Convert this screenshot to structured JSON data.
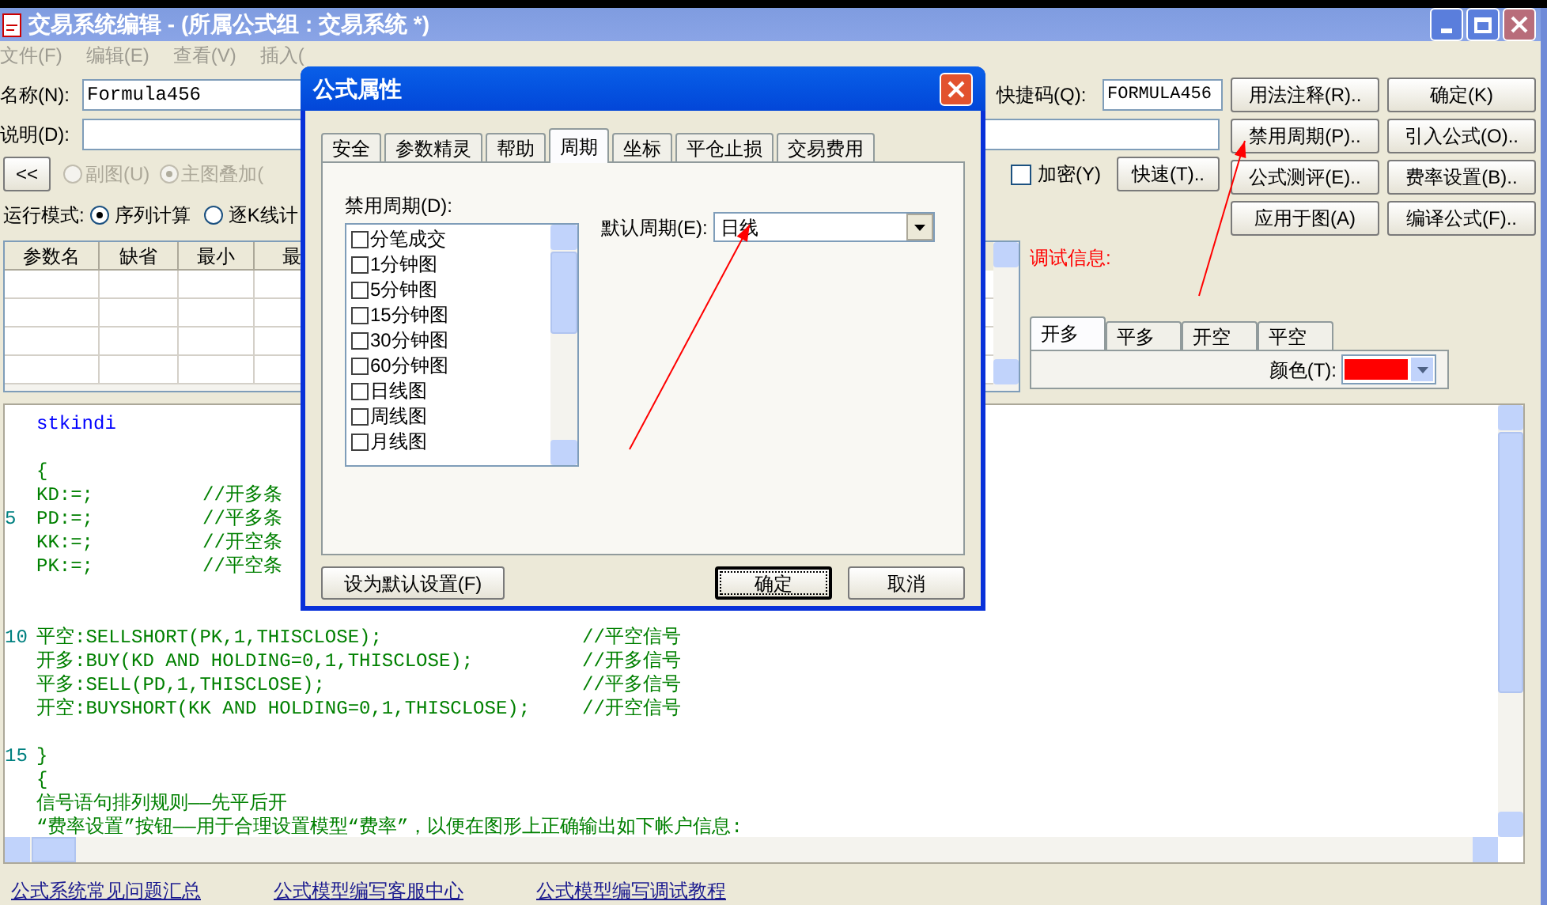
{
  "window": {
    "title": "交易系统编辑 - (所属公式组 : 交易系统 *)"
  },
  "menu": [
    "文件(F)",
    "编辑(E)",
    "查看(V)",
    "插入("
  ],
  "form": {
    "name_label": "名称(N):",
    "name_value": "Formula456",
    "shortcut_label": "快捷码(Q):",
    "shortcut_value": "FORMULA456",
    "desc_label": "说明(D):",
    "collapse_button": "<<",
    "chart_radios": [
      {
        "label": "副图(U)",
        "selected": false,
        "disabled": true
      },
      {
        "label": "主图叠加(",
        "selected": true,
        "disabled": true
      }
    ],
    "encrypt": {
      "label": "加密(Y)",
      "checked": false
    },
    "quick_button": "快速(T)..",
    "run_mode_label": "运行模式:",
    "run_modes": [
      {
        "label": "序列计算",
        "selected": true
      },
      {
        "label": "逐K线计",
        "selected": false
      }
    ]
  },
  "buttons": [
    "用法注释(R)..",
    "确定(K)",
    "禁用周期(P)..",
    "引入公式(O)..",
    "公式测评(E)..",
    "费率设置(B)..",
    "应用于图(A)",
    "编译公式(F).."
  ],
  "params_table": {
    "columns": [
      "参数名",
      "缺省",
      "最小",
      "最"
    ]
  },
  "debug": {
    "label": "调试信息:",
    "signal_tabs": [
      {
        "label": "开多",
        "selected": true
      },
      {
        "label": "平多",
        "selected": false
      },
      {
        "label": "开空",
        "selected": false
      },
      {
        "label": "平空",
        "selected": false
      }
    ],
    "color_label": "颜色(T):",
    "color": "#ff0000"
  },
  "editor": {
    "lines": [
      {
        "kind": "keyword",
        "code": "stkindi"
      },
      {
        "kind": "blank"
      },
      {
        "kind": "decl",
        "code": "{"
      },
      {
        "kind": "decl",
        "code": "KD:=;",
        "comment": "//开多条"
      },
      {
        "kind": "decl",
        "number": "5",
        "code": "PD:=;",
        "comment": "//平多条"
      },
      {
        "kind": "decl",
        "code": "KK:=;",
        "comment": "//开空条"
      },
      {
        "kind": "decl",
        "code": "PK:=;",
        "comment": "//平空条"
      },
      {
        "kind": "blank"
      },
      {
        "kind": "blank"
      },
      {
        "kind": "signal",
        "number": "10",
        "code": "平空:SELLSHORT(PK,1,THISCLOSE);",
        "comment": "//平空信号"
      },
      {
        "kind": "signal",
        "code": "开多:BUY(KD AND HOLDING=0,1,THISCLOSE);",
        "comment": "//开多信号"
      },
      {
        "kind": "signal",
        "code": "平多:SELL(PD,1,THISCLOSE);",
        "comment": "//平多信号"
      },
      {
        "kind": "signal",
        "code": "开空:BUYSHORT(KK AND HOLDING=0,1,THISCLOSE);",
        "comment": "//开空信号"
      },
      {
        "kind": "blank"
      },
      {
        "kind": "plain",
        "number": "15",
        "code": "}"
      },
      {
        "kind": "plain",
        "code": "{"
      },
      {
        "kind": "plain",
        "code": "信号语句排列规则——先平后开"
      },
      {
        "kind": "plain",
        "code": "“费率设置”按钮——用于合理设置模型“费率”，以便在图形上正确输出如下帐户信息:"
      }
    ]
  },
  "footer_links": [
    "公式系统常见问题汇总",
    "公式模型编写客服中心",
    "公式模型编写调试教程"
  ],
  "dialog": {
    "title": "公式属性",
    "tabs": [
      {
        "label": "安全",
        "selected": false
      },
      {
        "label": "参数精灵",
        "selected": false
      },
      {
        "label": "帮助",
        "selected": false
      },
      {
        "label": "周期",
        "selected": true
      },
      {
        "label": "坐标",
        "selected": false
      },
      {
        "label": "平仓止损",
        "selected": false
      },
      {
        "label": "交易费用",
        "selected": false
      }
    ],
    "disabled_periods_label": "禁用周期(D):",
    "periods": [
      {
        "label": "分笔成交",
        "checked": false
      },
      {
        "label": "1分钟图",
        "checked": false
      },
      {
        "label": "5分钟图",
        "checked": false
      },
      {
        "label": "15分钟图",
        "checked": false
      },
      {
        "label": "30分钟图",
        "checked": false
      },
      {
        "label": "60分钟图",
        "checked": false
      },
      {
        "label": "日线图",
        "checked": false
      },
      {
        "label": "周线图",
        "checked": false
      },
      {
        "label": "月线图",
        "checked": false
      }
    ],
    "default_period_label": "默认周期(E):",
    "default_period": "日线",
    "buttons": [
      {
        "label": "设为默认设置(F)",
        "default": false
      },
      {
        "label": "确定",
        "default": true
      },
      {
        "label": "取消",
        "default": false
      }
    ]
  }
}
